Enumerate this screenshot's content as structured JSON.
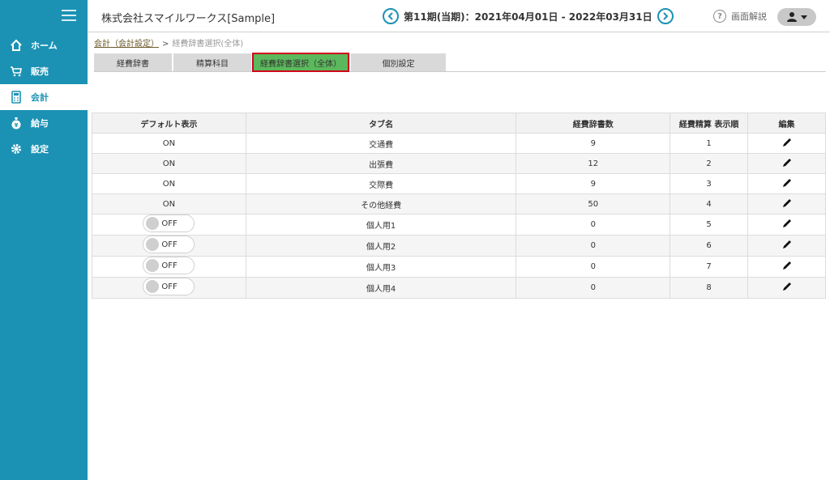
{
  "sidebar": {
    "items": [
      {
        "label": "ホーム",
        "icon": "home-icon"
      },
      {
        "label": "販売",
        "icon": "cart-icon"
      },
      {
        "label": "会計",
        "icon": "calculator-icon"
      },
      {
        "label": "給与",
        "icon": "money-bag-icon"
      },
      {
        "label": "設定",
        "icon": "gear-icon"
      }
    ],
    "active_index": 2,
    "accent": "#1b92b4"
  },
  "header": {
    "company": "株式会社スマイルワークス[Sample]",
    "period": "第11期(当期)：2021年04月01日 - 2022年03月31日",
    "help_label": "画面解説"
  },
  "breadcrumb": {
    "link": "会計（会計設定）",
    "separator": ">",
    "current": "経費辞書選択(全体)"
  },
  "tabs": [
    {
      "label": "経費辞書"
    },
    {
      "label": "精算科目"
    },
    {
      "label": "経費辞書選択（全体）"
    },
    {
      "label": "個別設定"
    }
  ],
  "table": {
    "headers": [
      "デフォルト表示",
      "タブ名",
      "経費辞書数",
      "経費精算 表示順",
      "編集"
    ],
    "rows": [
      {
        "default": "ON",
        "tab": "交通費",
        "count": "9",
        "order": "1"
      },
      {
        "default": "ON",
        "tab": "出張費",
        "count": "12",
        "order": "2"
      },
      {
        "default": "ON",
        "tab": "交際費",
        "count": "9",
        "order": "3"
      },
      {
        "default": "ON",
        "tab": "その他経費",
        "count": "50",
        "order": "4"
      },
      {
        "default": "OFF",
        "tab": "個人用1",
        "count": "0",
        "order": "5"
      },
      {
        "default": "OFF",
        "tab": "個人用2",
        "count": "0",
        "order": "6"
      },
      {
        "default": "OFF",
        "tab": "個人用3",
        "count": "0",
        "order": "7"
      },
      {
        "default": "OFF",
        "tab": "個人用4",
        "count": "0",
        "order": "8"
      }
    ]
  }
}
